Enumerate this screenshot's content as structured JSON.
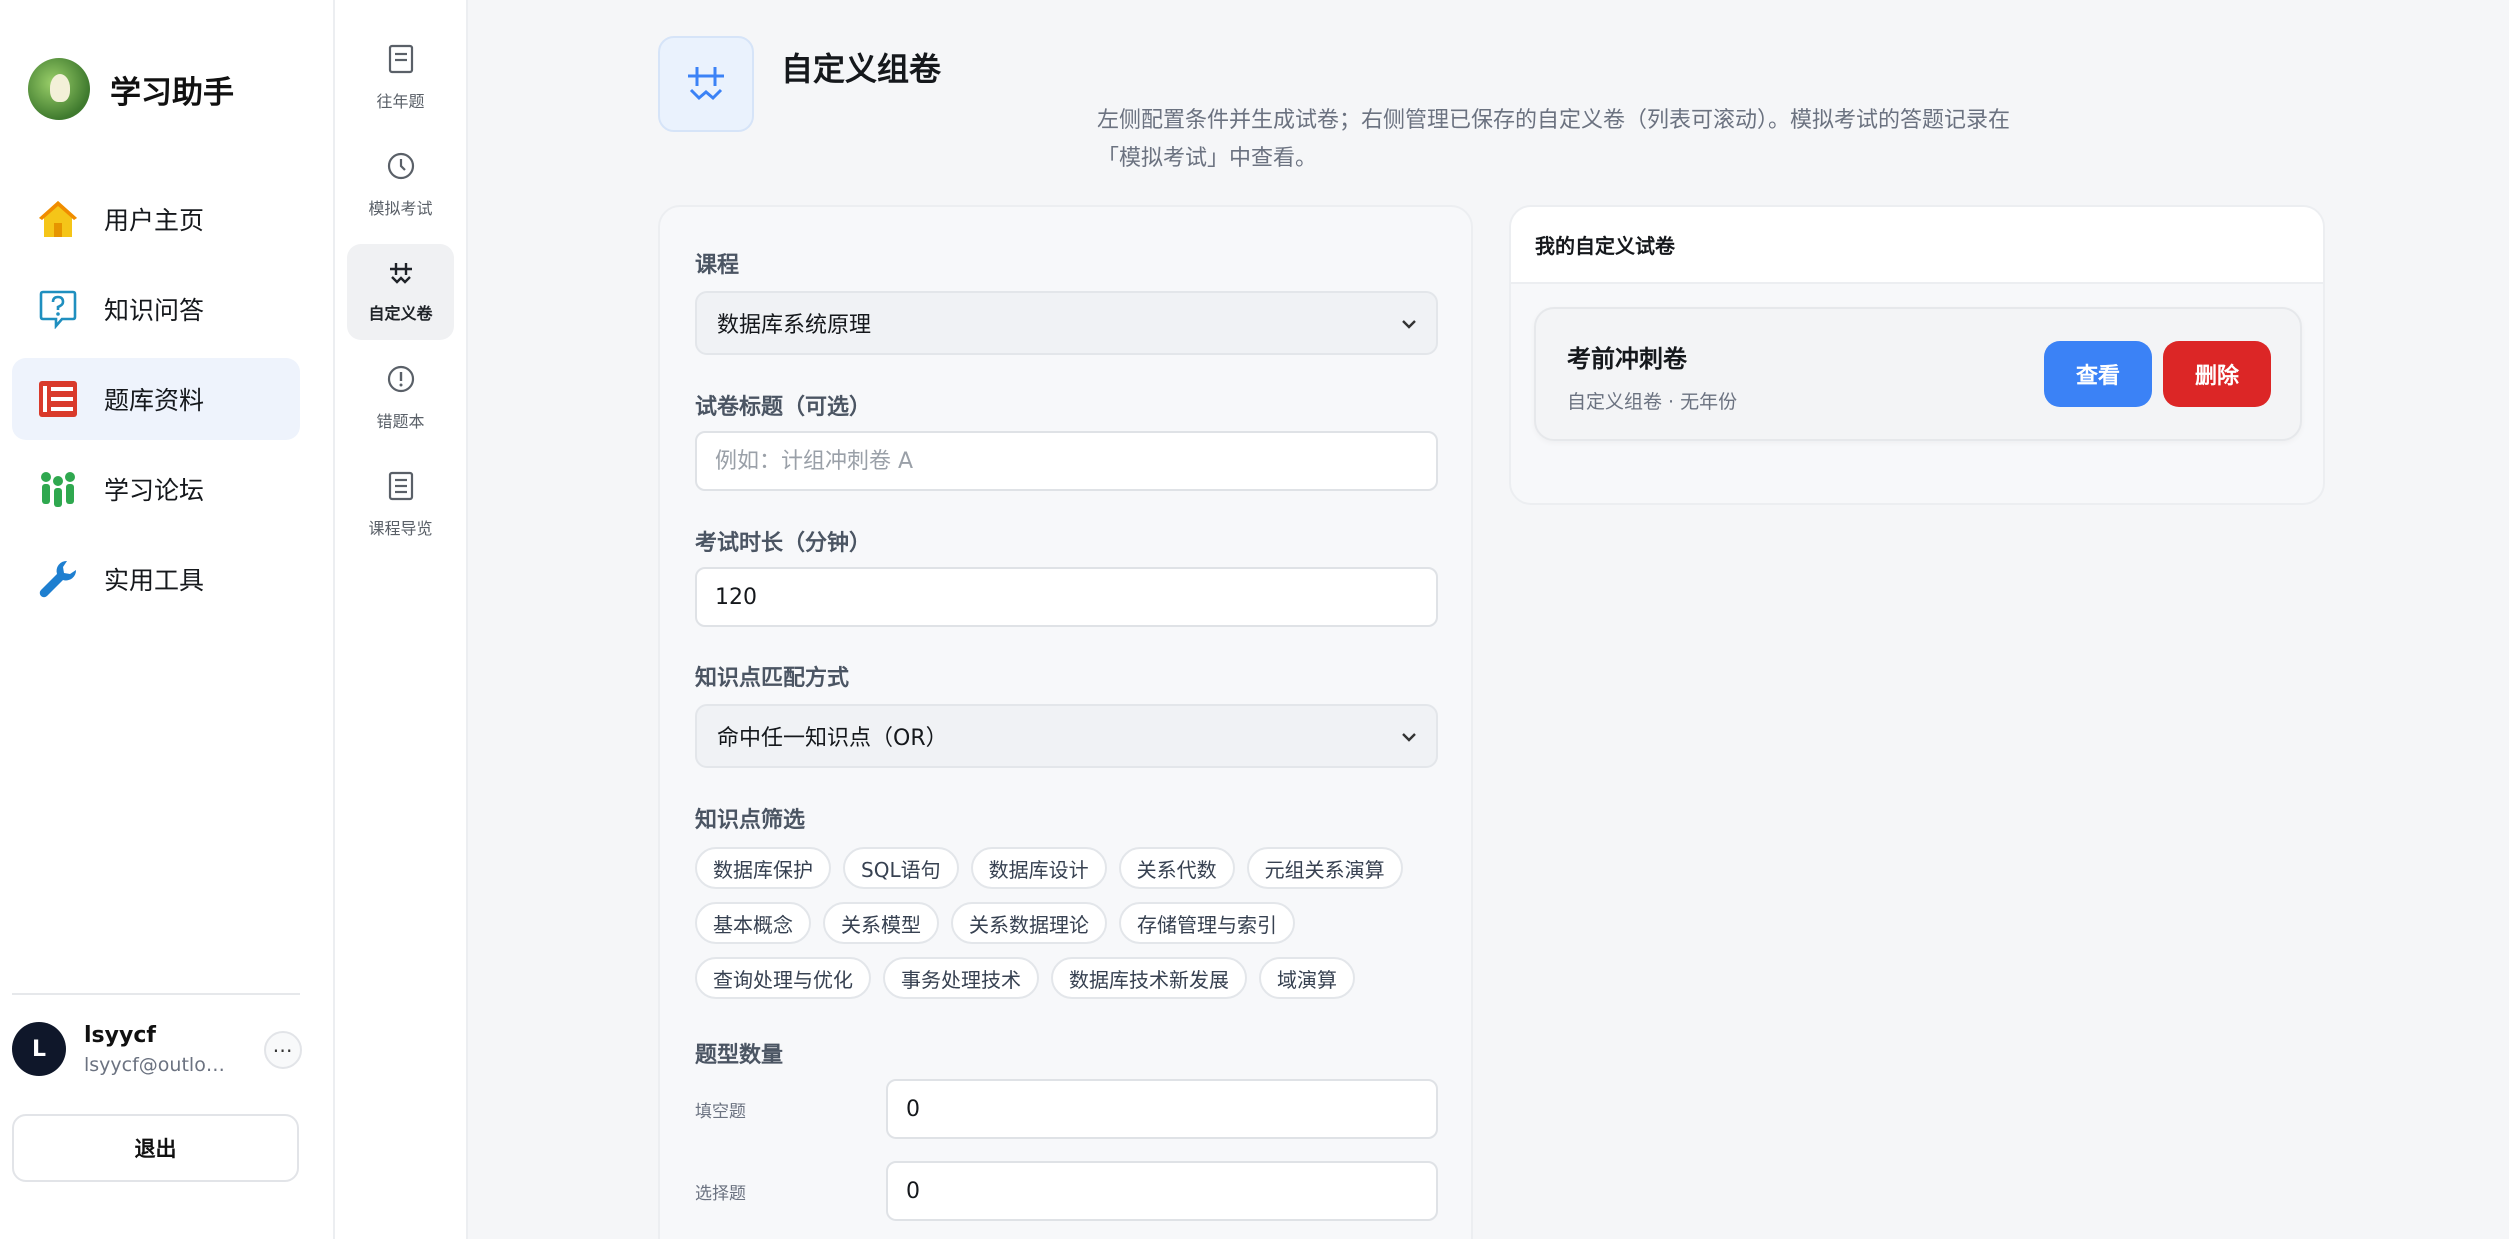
{
  "brand": {
    "name": "学习助手"
  },
  "sidebar": {
    "items": [
      {
        "label": "用户主页",
        "icon": "home-icon",
        "active": false
      },
      {
        "label": "知识问答",
        "icon": "chat-question-icon",
        "active": false
      },
      {
        "label": "题库资料",
        "icon": "books-icon",
        "active": true
      },
      {
        "label": "学习论坛",
        "icon": "people-icon",
        "active": false
      },
      {
        "label": "实用工具",
        "icon": "wrench-icon",
        "active": false
      }
    ]
  },
  "user": {
    "avatar_letter": "L",
    "name": "lsyycf",
    "email": "lsyycf@outlook.com",
    "more": "⋯"
  },
  "logout_label": "退出",
  "subnav": {
    "items": [
      {
        "label": "往年题",
        "icon": "document-icon",
        "active": false
      },
      {
        "label": "模拟考试",
        "icon": "clock-icon",
        "active": false
      },
      {
        "label": "自定义卷",
        "icon": "custom-paper-icon",
        "active": true
      },
      {
        "label": "错题本",
        "icon": "alert-circle-icon",
        "active": false
      },
      {
        "label": "课程导览",
        "icon": "book-icon",
        "active": false
      }
    ]
  },
  "page": {
    "title": "自定义组卷",
    "description": "左侧配置条件并生成试卷；右侧管理已保存的自定义卷（列表可滚动）。模拟考试的答题记录在「模拟考试」中查看。"
  },
  "form": {
    "course_label": "课程",
    "course_value": "数据库系统原理",
    "paper_title_label": "试卷标题（可选）",
    "paper_title_placeholder": "例如：计组冲刺卷 A",
    "paper_title_value": "",
    "duration_label": "考试时长（分钟）",
    "duration_value": "120",
    "match_label": "知识点匹配方式",
    "match_value": "命中任一知识点（OR）",
    "filter_label": "知识点筛选",
    "tags": [
      [
        "数据库保护",
        "SQL语句",
        "数据库设计",
        "关系代数",
        "元组关系演算"
      ],
      [
        "基本概念",
        "关系模型",
        "关系数据理论",
        "存储管理与索引"
      ],
      [
        "查询处理与优化",
        "事务处理技术",
        "数据库技术新发展",
        "域演算"
      ]
    ],
    "type_count_label": "题型数量",
    "types": [
      {
        "label": "填空题",
        "value": "0"
      },
      {
        "label": "选择题",
        "value": "0"
      }
    ]
  },
  "saved": {
    "header": "我的自定义试卷",
    "items": [
      {
        "title": "考前冲刺卷",
        "meta": "自定义组卷 · 无年份",
        "view_label": "查看",
        "delete_label": "删除"
      }
    ]
  },
  "colors": {
    "primary": "#3b82f6",
    "danger": "#dc2626",
    "active_bg": "#eef3fc"
  }
}
